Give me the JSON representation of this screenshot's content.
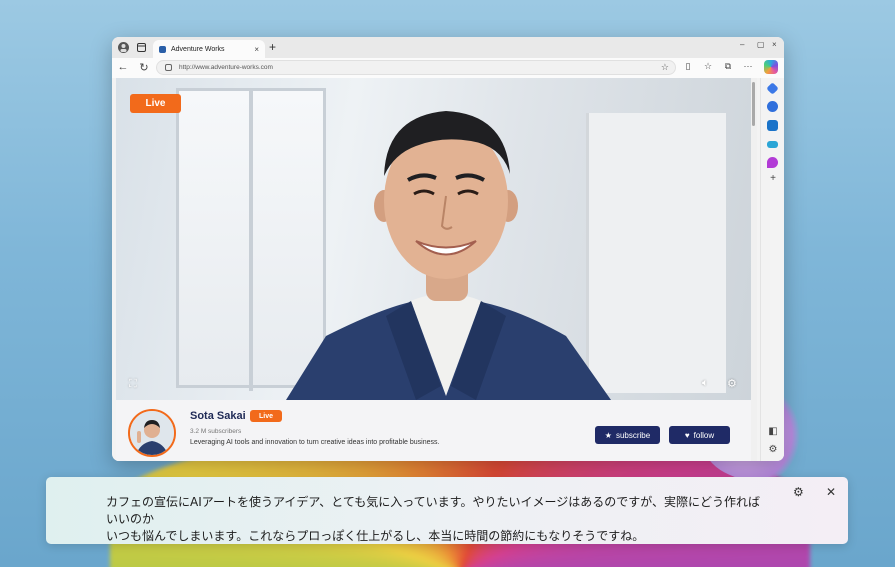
{
  "browser": {
    "tab_title": "Adventure Works",
    "url": "http://www.adventure-works.com",
    "new_tab_glyph": "+",
    "tab_close_glyph": "×",
    "window_controls": [
      "–",
      "▢",
      "×"
    ]
  },
  "video": {
    "live_label": "Live",
    "icons": {
      "fullscreen": "fullscreen-icon",
      "volume": "volume-icon",
      "settings": "settings-icon"
    }
  },
  "channel": {
    "name": "Sota Sakai",
    "live_label": "Live",
    "subscribers": "3.2 M subscribers",
    "description": "Leveraging AI tools and innovation to turn creative ideas into profitable business.",
    "subscribe_label": "subscribe",
    "follow_label": "follow"
  },
  "caption": {
    "line1": "カフェの宣伝にAIアートを使うアイデア、とても気に入っています。やりたいイメージはあるのですが、実際にどう作ればいいのか",
    "line2": "いつも悩んでしまいます。これならプロっぽく仕上がるし、本当に時間の節約にもなりそうですね。"
  },
  "colors": {
    "accent_live": "#f26a1b",
    "button_navy": "#1f2a66",
    "channel_name": "#1f2a56"
  }
}
